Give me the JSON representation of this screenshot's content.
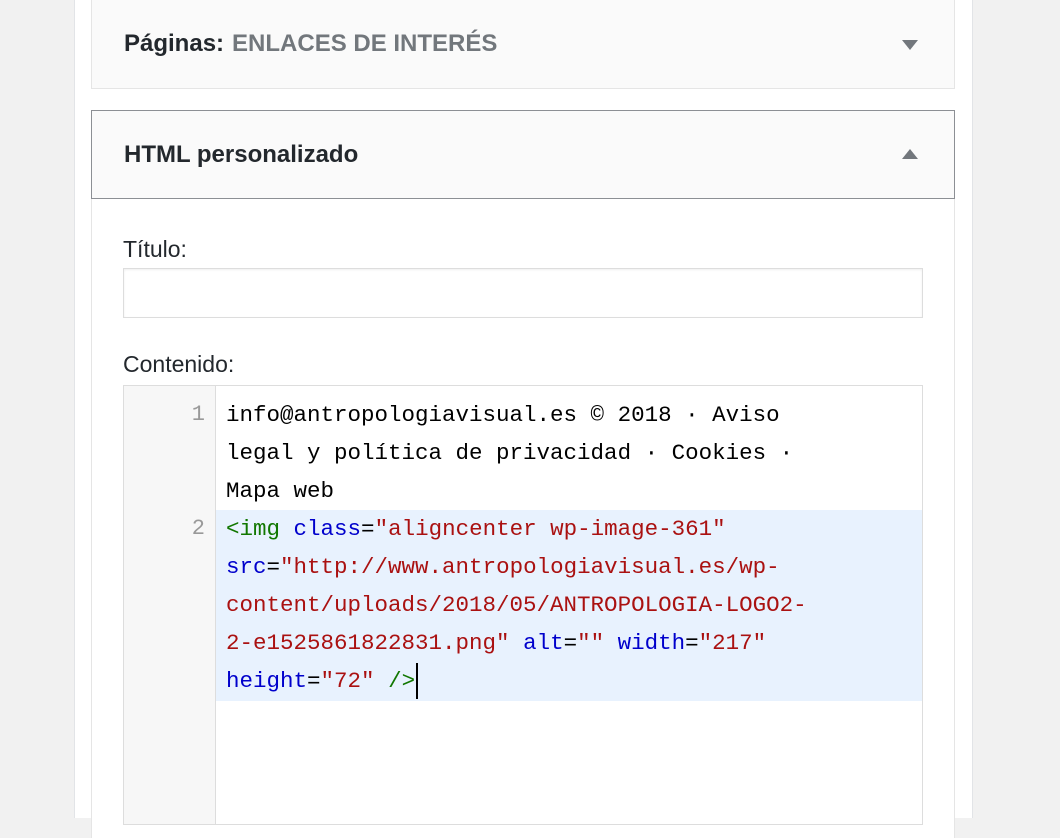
{
  "pages_widget": {
    "label": "Páginas:",
    "name": "ENLACES DE INTERÉS",
    "toggle_icon": "arrow-down-icon"
  },
  "html_widget": {
    "label": "HTML personalizado",
    "toggle_icon": "arrow-up-icon",
    "title_label": "Título:",
    "title_value": "",
    "content_label": "Contenido:",
    "editor": {
      "line_numbers": [
        "1",
        "2"
      ],
      "line1_rows": [
        "info@antropologiavisual.es © 2018 · Aviso",
        "legal y política de privacidad · Cookies ·",
        "Mapa web"
      ],
      "line2": {
        "tag_open": "<img",
        "attr_class": "class",
        "val_class": "\"aligncenter  wp-image-361\"",
        "attr_src": "src",
        "val_src_row1": "\"http://www.antropologiavisual.es/wp-",
        "val_src_row2": "content/uploads/2018/05/ANTROPOLOGIA-LOGO2-",
        "val_src_row3": "2-e1525861822831.png\"",
        "attr_alt": "alt",
        "val_alt": "\"\"",
        "attr_width": "width",
        "val_width": "\"217\"",
        "attr_height": "height",
        "val_height": "\"72\"",
        "tag_close": "/>"
      },
      "eq": "="
    }
  },
  "colors": {
    "tag": "#117700",
    "attribute": "#0000cc",
    "string": "#aa1111",
    "active_line": "#e8f2fe"
  }
}
